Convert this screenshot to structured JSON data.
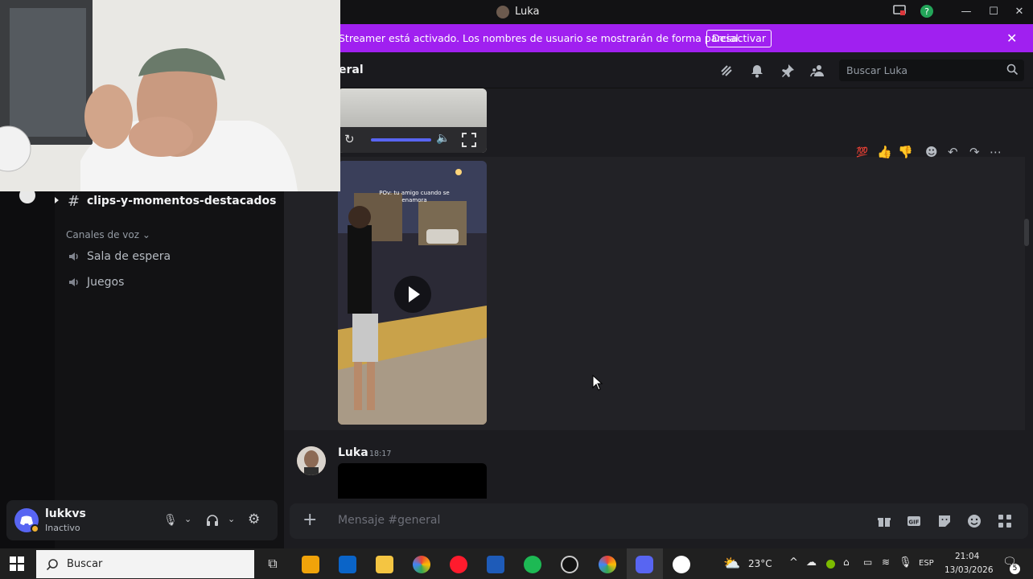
{
  "window": {
    "title": "Luka"
  },
  "banner": {
    "message": "Streamer está activado. Los nombres de usuario se mostrarán de forma parcial.",
    "button": "Desactivar"
  },
  "sidebar": {
    "text_channel": "clips-y-momentos-destacados",
    "voice_category": "Canales de voz",
    "voice_channels": [
      "Sala de espera",
      "Juegos"
    ]
  },
  "user": {
    "name": "lukkvs",
    "status": "Inactivo"
  },
  "header": {
    "channel_title": "eral",
    "search_placeholder": "Buscar Luka"
  },
  "video_caption": "POv: tu amigo cuando se enamora",
  "message": {
    "author": "Luka",
    "time": "18:17"
  },
  "composer": {
    "placeholder": "Mensaje #general"
  },
  "taskbar": {
    "search_placeholder": "Buscar",
    "weather": "23°C",
    "language": "ESP",
    "time": "21:04",
    "date": "13/03/2026",
    "notif_count": "5"
  },
  "colors": {
    "banner": "#a020f0",
    "accent": "#5865f2",
    "idle": "#f0b232"
  }
}
